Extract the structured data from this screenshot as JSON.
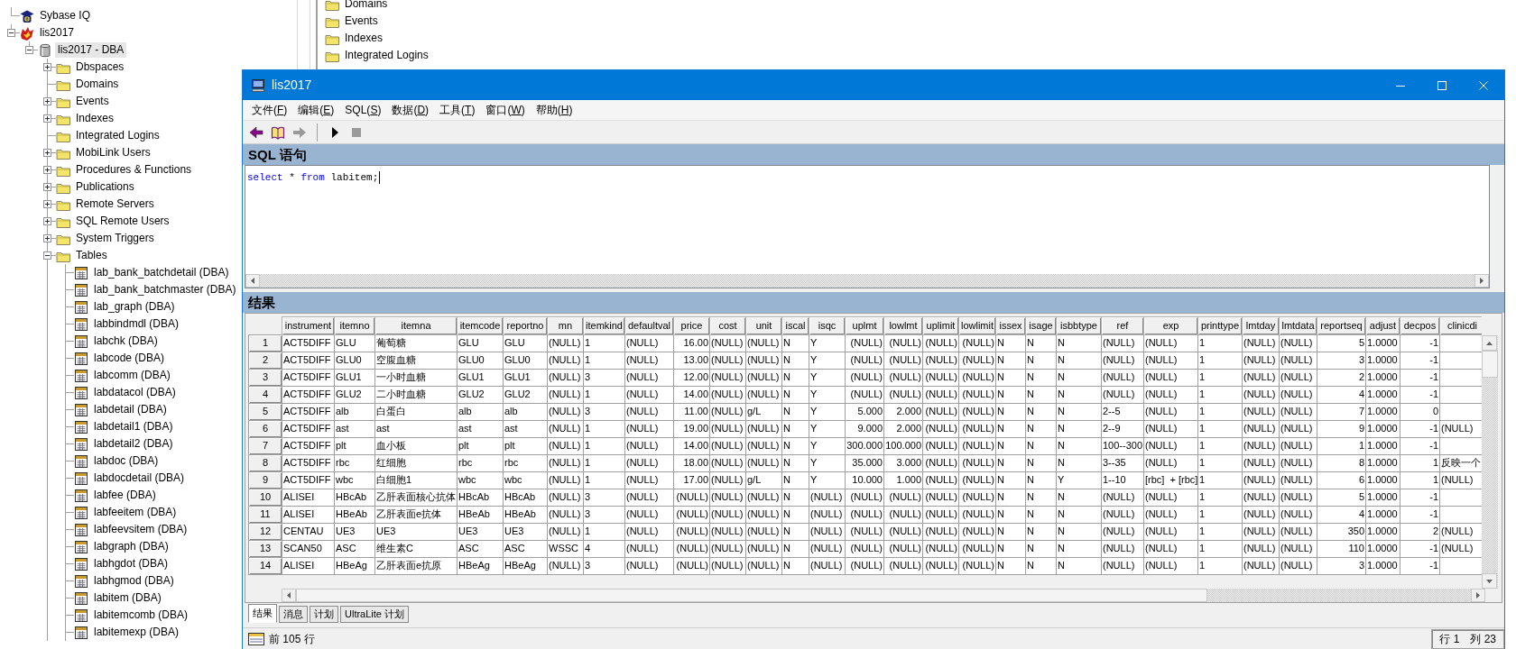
{
  "background_tree": [
    {
      "label": "Sybase IQ",
      "kind": "sybase-iq",
      "expandable": false,
      "selected": false
    },
    {
      "label": "lis2017",
      "kind": "server",
      "expandable": true,
      "expanded": true,
      "selected": false,
      "children": [
        {
          "label": "lis2017 - DBA",
          "kind": "database",
          "expandable": true,
          "expanded": true,
          "selected": true,
          "children": [
            {
              "label": "Dbspaces",
              "kind": "folder",
              "expandable": true,
              "expanded": false,
              "selected": false
            },
            {
              "label": "Domains",
              "kind": "folder",
              "expandable": false,
              "selected": false
            },
            {
              "label": "Events",
              "kind": "folder",
              "expandable": true,
              "expanded": false,
              "selected": false
            },
            {
              "label": "Indexes",
              "kind": "folder",
              "expandable": true,
              "expanded": false,
              "selected": false
            },
            {
              "label": "Integrated Logins",
              "kind": "folder",
              "expandable": false,
              "selected": false
            },
            {
              "label": "MobiLink Users",
              "kind": "folder",
              "expandable": true,
              "expanded": false,
              "selected": false
            },
            {
              "label": "Procedures & Functions",
              "kind": "folder",
              "expandable": true,
              "expanded": false,
              "selected": false
            },
            {
              "label": "Publications",
              "kind": "folder",
              "expandable": true,
              "expanded": false,
              "selected": false
            },
            {
              "label": "Remote Servers",
              "kind": "folder",
              "expandable": true,
              "expanded": false,
              "selected": false
            },
            {
              "label": "SQL Remote Users",
              "kind": "folder",
              "expandable": true,
              "expanded": false,
              "selected": false
            },
            {
              "label": "System Triggers",
              "kind": "folder",
              "expandable": true,
              "expanded": false,
              "selected": false
            },
            {
              "label": "Tables",
              "kind": "folder",
              "expandable": true,
              "expanded": true,
              "selected": false,
              "children": [
                {
                  "label": "lab_bank_batchdetail (DBA)",
                  "kind": "table",
                  "expandable": false,
                  "selected": false
                },
                {
                  "label": "lab_bank_batchmaster (DBA)",
                  "kind": "table",
                  "expandable": false,
                  "selected": false
                },
                {
                  "label": "lab_graph (DBA)",
                  "kind": "table",
                  "expandable": false,
                  "selected": false
                },
                {
                  "label": "labbindmdl (DBA)",
                  "kind": "table",
                  "expandable": false,
                  "selected": false
                },
                {
                  "label": "labchk (DBA)",
                  "kind": "table",
                  "expandable": false,
                  "selected": false
                },
                {
                  "label": "labcode (DBA)",
                  "kind": "table",
                  "expandable": false,
                  "selected": false
                },
                {
                  "label": "labcomm (DBA)",
                  "kind": "table",
                  "expandable": false,
                  "selected": false
                },
                {
                  "label": "labdatacol (DBA)",
                  "kind": "table",
                  "expandable": false,
                  "selected": false
                },
                {
                  "label": "labdetail (DBA)",
                  "kind": "table",
                  "expandable": false,
                  "selected": false
                },
                {
                  "label": "labdetail1 (DBA)",
                  "kind": "table",
                  "expandable": false,
                  "selected": false
                },
                {
                  "label": "labdetail2 (DBA)",
                  "kind": "table",
                  "expandable": false,
                  "selected": false
                },
                {
                  "label": "labdoc (DBA)",
                  "kind": "table",
                  "expandable": false,
                  "selected": false
                },
                {
                  "label": "labdocdetail (DBA)",
                  "kind": "table",
                  "expandable": false,
                  "selected": false
                },
                {
                  "label": "labfee (DBA)",
                  "kind": "table",
                  "expandable": false,
                  "selected": false
                },
                {
                  "label": "labfeeitem (DBA)",
                  "kind": "table",
                  "expandable": false,
                  "selected": false
                },
                {
                  "label": "labfeevsitem (DBA)",
                  "kind": "table",
                  "expandable": false,
                  "selected": false
                },
                {
                  "label": "labgraph (DBA)",
                  "kind": "table",
                  "expandable": false,
                  "selected": false
                },
                {
                  "label": "labhgdot (DBA)",
                  "kind": "table",
                  "expandable": false,
                  "selected": false
                },
                {
                  "label": "labhgmod (DBA)",
                  "kind": "table",
                  "expandable": false,
                  "selected": false
                },
                {
                  "label": "labitem (DBA)",
                  "kind": "table",
                  "expandable": false,
                  "selected": false
                },
                {
                  "label": "labitemcomb (DBA)",
                  "kind": "table",
                  "expandable": false,
                  "selected": false
                },
                {
                  "label": "labitemexp (DBA)",
                  "kind": "table",
                  "expandable": false,
                  "selected": false
                }
              ]
            }
          ]
        }
      ]
    }
  ],
  "background_list": [
    {
      "label": "Domains"
    },
    {
      "label": "Events"
    },
    {
      "label": "Indexes"
    },
    {
      "label": "Integrated Logins"
    }
  ],
  "window": {
    "title": "lis2017"
  },
  "menu": [
    {
      "label": "文件(F)"
    },
    {
      "label": "编辑(E)"
    },
    {
      "label": "SQL(S)"
    },
    {
      "label": "数据(D)"
    },
    {
      "label": "工具(T)"
    },
    {
      "label": "窗口(W)"
    },
    {
      "label": "帮助(H)"
    }
  ],
  "toolbar": [
    {
      "kind": "back",
      "disabled": false
    },
    {
      "kind": "book",
      "disabled": false
    },
    {
      "kind": "forward",
      "disabled": true
    },
    {
      "kind": "separator"
    },
    {
      "kind": "run",
      "disabled": false
    },
    {
      "kind": "stop",
      "disabled": true
    }
  ],
  "sql_panel": {
    "title": "SQL 语句",
    "code": [
      {
        "text": "select",
        "kind": "keyword"
      },
      {
        "text": " * ",
        "kind": "plain"
      },
      {
        "text": "from",
        "kind": "keyword"
      },
      {
        "text": " labitem;",
        "kind": "plain"
      }
    ]
  },
  "results_panel": {
    "title": "结果",
    "columns": [
      {
        "label": "instrument",
        "kind": "text"
      },
      {
        "label": "itemno",
        "kind": "text"
      },
      {
        "label": "itemna",
        "kind": "text"
      },
      {
        "label": "itemcode",
        "kind": "text"
      },
      {
        "label": "reportno",
        "kind": "text"
      },
      {
        "label": "mn",
        "kind": "text"
      },
      {
        "label": "itemkind",
        "kind": "text"
      },
      {
        "label": "defaultval",
        "kind": "text"
      },
      {
        "label": "price",
        "kind": "numeric"
      },
      {
        "label": "cost",
        "kind": "text"
      },
      {
        "label": "unit",
        "kind": "text"
      },
      {
        "label": "iscal",
        "kind": "text"
      },
      {
        "label": "isqc",
        "kind": "text"
      },
      {
        "label": "uplmt",
        "kind": "numeric"
      },
      {
        "label": "lowlmt",
        "kind": "numeric"
      },
      {
        "label": "uplimit",
        "kind": "numeric"
      },
      {
        "label": "lowlimit",
        "kind": "numeric"
      },
      {
        "label": "issex",
        "kind": "text"
      },
      {
        "label": "isage",
        "kind": "text"
      },
      {
        "label": "isbbtype",
        "kind": "text"
      },
      {
        "label": "ref",
        "kind": "text"
      },
      {
        "label": "exp",
        "kind": "text"
      },
      {
        "label": "printtype",
        "kind": "text"
      },
      {
        "label": "lmtday",
        "kind": "text"
      },
      {
        "label": "lmtdata",
        "kind": "text"
      },
      {
        "label": "reportseq",
        "kind": "numeric"
      },
      {
        "label": "adjust",
        "kind": "text"
      },
      {
        "label": "decpos",
        "kind": "numeric"
      },
      {
        "label": "clinicdi",
        "kind": "text"
      }
    ],
    "rows": [
      {
        "header": "1",
        "cells": [
          "ACT5DIFF",
          "GLU",
          "葡萄糖",
          "GLU",
          "GLU",
          "(NULL)",
          "1",
          "(NULL)",
          "16.00",
          "(NULL)",
          "(NULL)",
          "N",
          "Y",
          "(NULL)",
          "(NULL)",
          "(NULL)",
          "(NULL)",
          "N",
          "N",
          "N",
          "(NULL)",
          "(NULL)",
          "1",
          "(NULL)",
          "(NULL)",
          "5",
          "1.0000",
          "-1"
        ]
      },
      {
        "header": "2",
        "cells": [
          "ACT5DIFF",
          "GLU0",
          "空腹血糖",
          "GLU0",
          "GLU0",
          "(NULL)",
          "1",
          "(NULL)",
          "13.00",
          "(NULL)",
          "(NULL)",
          "N",
          "Y",
          "(NULL)",
          "(NULL)",
          "(NULL)",
          "(NULL)",
          "N",
          "N",
          "N",
          "(NULL)",
          "(NULL)",
          "1",
          "(NULL)",
          "(NULL)",
          "3",
          "1.0000",
          "-1"
        ]
      },
      {
        "header": "3",
        "cells": [
          "ACT5DIFF",
          "GLU1",
          "一小时血糖",
          "GLU1",
          "GLU1",
          "(NULL)",
          "3",
          "(NULL)",
          "12.00",
          "(NULL)",
          "(NULL)",
          "N",
          "Y",
          "(NULL)",
          "(NULL)",
          "(NULL)",
          "(NULL)",
          "N",
          "N",
          "N",
          "(NULL)",
          "(NULL)",
          "1",
          "(NULL)",
          "(NULL)",
          "2",
          "1.0000",
          "-1"
        ]
      },
      {
        "header": "4",
        "cells": [
          "ACT5DIFF",
          "GLU2",
          "二小时血糖",
          "GLU2",
          "GLU2",
          "(NULL)",
          "1",
          "(NULL)",
          "14.00",
          "(NULL)",
          "(NULL)",
          "N",
          "Y",
          "(NULL)",
          "(NULL)",
          "(NULL)",
          "(NULL)",
          "N",
          "N",
          "N",
          "(NULL)",
          "(NULL)",
          "1",
          "(NULL)",
          "(NULL)",
          "4",
          "1.0000",
          "-1"
        ]
      },
      {
        "header": "5",
        "cells": [
          "ACT5DIFF",
          "alb",
          "白蛋白",
          "alb",
          "alb",
          "(NULL)",
          "3",
          "(NULL)",
          "11.00",
          "(NULL)",
          "g/L",
          "N",
          "Y",
          "5.000",
          "2.000",
          "(NULL)",
          "(NULL)",
          "N",
          "N",
          "N",
          "2--5",
          "(NULL)",
          "1",
          "(NULL)",
          "(NULL)",
          "7",
          "1.0000",
          "0"
        ]
      },
      {
        "header": "6",
        "cells": [
          "ACT5DIFF",
          "ast",
          "ast",
          "ast",
          "ast",
          "(NULL)",
          "1",
          "(NULL)",
          "19.00",
          "(NULL)",
          "(NULL)",
          "N",
          "Y",
          "9.000",
          "2.000",
          "(NULL)",
          "(NULL)",
          "N",
          "N",
          "N",
          "2--9",
          "(NULL)",
          "1",
          "(NULL)",
          "(NULL)",
          "9",
          "1.0000",
          "-1",
          "(NULL)"
        ]
      },
      {
        "header": "7",
        "cells": [
          "ACT5DIFF",
          "plt",
          "血小板",
          "plt",
          "plt",
          "(NULL)",
          "1",
          "(NULL)",
          "14.00",
          "(NULL)",
          "(NULL)",
          "N",
          "Y",
          "300.000",
          "100.000",
          "(NULL)",
          "(NULL)",
          "N",
          "N",
          "N",
          "100--300",
          "(NULL)",
          "1",
          "(NULL)",
          "(NULL)",
          "1",
          "1.0000",
          "-1"
        ]
      },
      {
        "header": "8",
        "cells": [
          "ACT5DIFF",
          "rbc",
          "红细胞",
          "rbc",
          "rbc",
          "(NULL)",
          "1",
          "(NULL)",
          "18.00",
          "(NULL)",
          "(NULL)",
          "N",
          "Y",
          "35.000",
          "3.000",
          "(NULL)",
          "(NULL)",
          "N",
          "N",
          "N",
          "3--35",
          "(NULL)",
          "1",
          "(NULL)",
          "(NULL)",
          "8",
          "1.0000",
          "1",
          "反映一个"
        ]
      },
      {
        "header": "9",
        "cells": [
          "ACT5DIFF",
          "wbc",
          "白细胞1",
          "wbc",
          "wbc",
          "(NULL)",
          "1",
          "(NULL)",
          "17.00",
          "(NULL)",
          "g/L",
          "N",
          "Y",
          "10.000",
          "1.000",
          "(NULL)",
          "(NULL)",
          "N",
          "N",
          "Y",
          "1--10",
          "[rbc]  + [rbc]",
          "1",
          "(NULL)",
          "(NULL)",
          "6",
          "1.0000",
          "1",
          "(NULL)"
        ]
      },
      {
        "header": "10",
        "cells": [
          "ALISEI",
          "HBcAb",
          "乙肝表面核心抗体",
          "HBcAb",
          "HBcAb",
          "(NULL)",
          "3",
          "(NULL)",
          "(NULL)",
          "(NULL)",
          "(NULL)",
          "N",
          "(NULL)",
          "(NULL)",
          "(NULL)",
          "(NULL)",
          "(NULL)",
          "N",
          "N",
          "N",
          "(NULL)",
          "(NULL)",
          "1",
          "(NULL)",
          "(NULL)",
          "5",
          "1.0000",
          "-1"
        ]
      },
      {
        "header": "11",
        "cells": [
          "ALISEI",
          "HBeAb",
          "乙肝表面e抗体",
          "HBeAb",
          "HBeAb",
          "(NULL)",
          "3",
          "(NULL)",
          "(NULL)",
          "(NULL)",
          "(NULL)",
          "N",
          "(NULL)",
          "(NULL)",
          "(NULL)",
          "(NULL)",
          "(NULL)",
          "N",
          "N",
          "N",
          "(NULL)",
          "(NULL)",
          "1",
          "(NULL)",
          "(NULL)",
          "4",
          "1.0000",
          "-1"
        ]
      },
      {
        "header": "12",
        "cells": [
          "CENTAU",
          "UE3",
          "UE3",
          "UE3",
          "UE3",
          "(NULL)",
          "1",
          "(NULL)",
          "(NULL)",
          "(NULL)",
          "(NULL)",
          "N",
          "(NULL)",
          "(NULL)",
          "(NULL)",
          "(NULL)",
          "(NULL)",
          "N",
          "N",
          "N",
          "(NULL)",
          "(NULL)",
          "1",
          "(NULL)",
          "(NULL)",
          "350",
          "1.0000",
          "2",
          "(NULL)"
        ]
      },
      {
        "header": "13",
        "cells": [
          "SCAN50",
          "ASC",
          "维生素C",
          "ASC",
          "ASC",
          "WSSC",
          "4",
          "(NULL)",
          "(NULL)",
          "(NULL)",
          "(NULL)",
          "N",
          "(NULL)",
          "(NULL)",
          "(NULL)",
          "(NULL)",
          "(NULL)",
          "N",
          "N",
          "N",
          "(NULL)",
          "(NULL)",
          "1",
          "(NULL)",
          "(NULL)",
          "110",
          "1.0000",
          "-1",
          "(NULL)"
        ]
      },
      {
        "header": "14",
        "cells": [
          "ALISEI",
          "HBeAg",
          "乙肝表面e抗原",
          "HBeAg",
          "HBeAg",
          "(NULL)",
          "3",
          "(NULL)",
          "(NULL)",
          "(NULL)",
          "(NULL)",
          "N",
          "(NULL)",
          "(NULL)",
          "(NULL)",
          "(NULL)",
          "(NULL)",
          "N",
          "N",
          "N",
          "(NULL)",
          "(NULL)",
          "1",
          "(NULL)",
          "(NULL)",
          "3",
          "1.0000",
          "-1"
        ]
      }
    ]
  },
  "result_tabs": [
    {
      "label": "结果",
      "selected": true
    },
    {
      "label": "消息",
      "selected": false
    },
    {
      "label": "计划",
      "selected": false
    },
    {
      "label": "UltraLite 计划",
      "selected": false
    }
  ],
  "status_bar": {
    "text": "前 105 行",
    "row": "行 1",
    "column": "列 23"
  }
}
